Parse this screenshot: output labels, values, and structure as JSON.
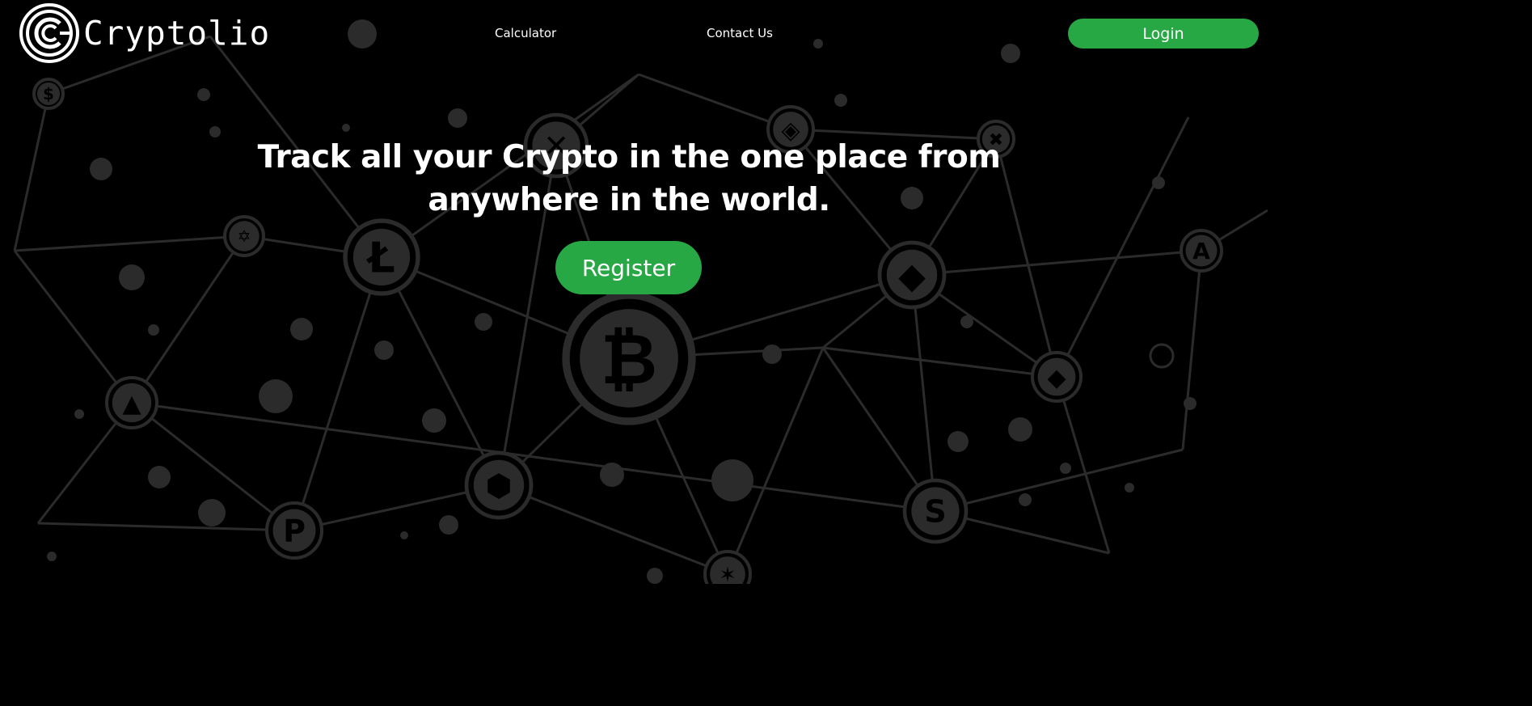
{
  "brand": {
    "name": "Cryptolio",
    "logo_icon": "crypto-coin-c-icon"
  },
  "nav": {
    "calculator_label": "Calculator",
    "contact_label": "Contact Us",
    "login_label": "Login"
  },
  "hero": {
    "headline": "Track all your Crypto in the one place from anywhere in the world.",
    "register_label": "Register"
  },
  "background": {
    "coin_icons": [
      "bitcoin-icon",
      "litecoin-icon",
      "ethereum-icon",
      "binance-icon",
      "xrp-icon",
      "eos-icon",
      "chainlink-icon",
      "polkadot-icon",
      "stellar-icon",
      "algorand-icon",
      "tezos-icon",
      "monero-icon",
      "yearn-icon",
      "nano-icon",
      "cardano-icon"
    ]
  },
  "colors": {
    "background": "#000000",
    "accent": "#28a745",
    "text": "#ffffff",
    "network": "#2b2b2b"
  }
}
